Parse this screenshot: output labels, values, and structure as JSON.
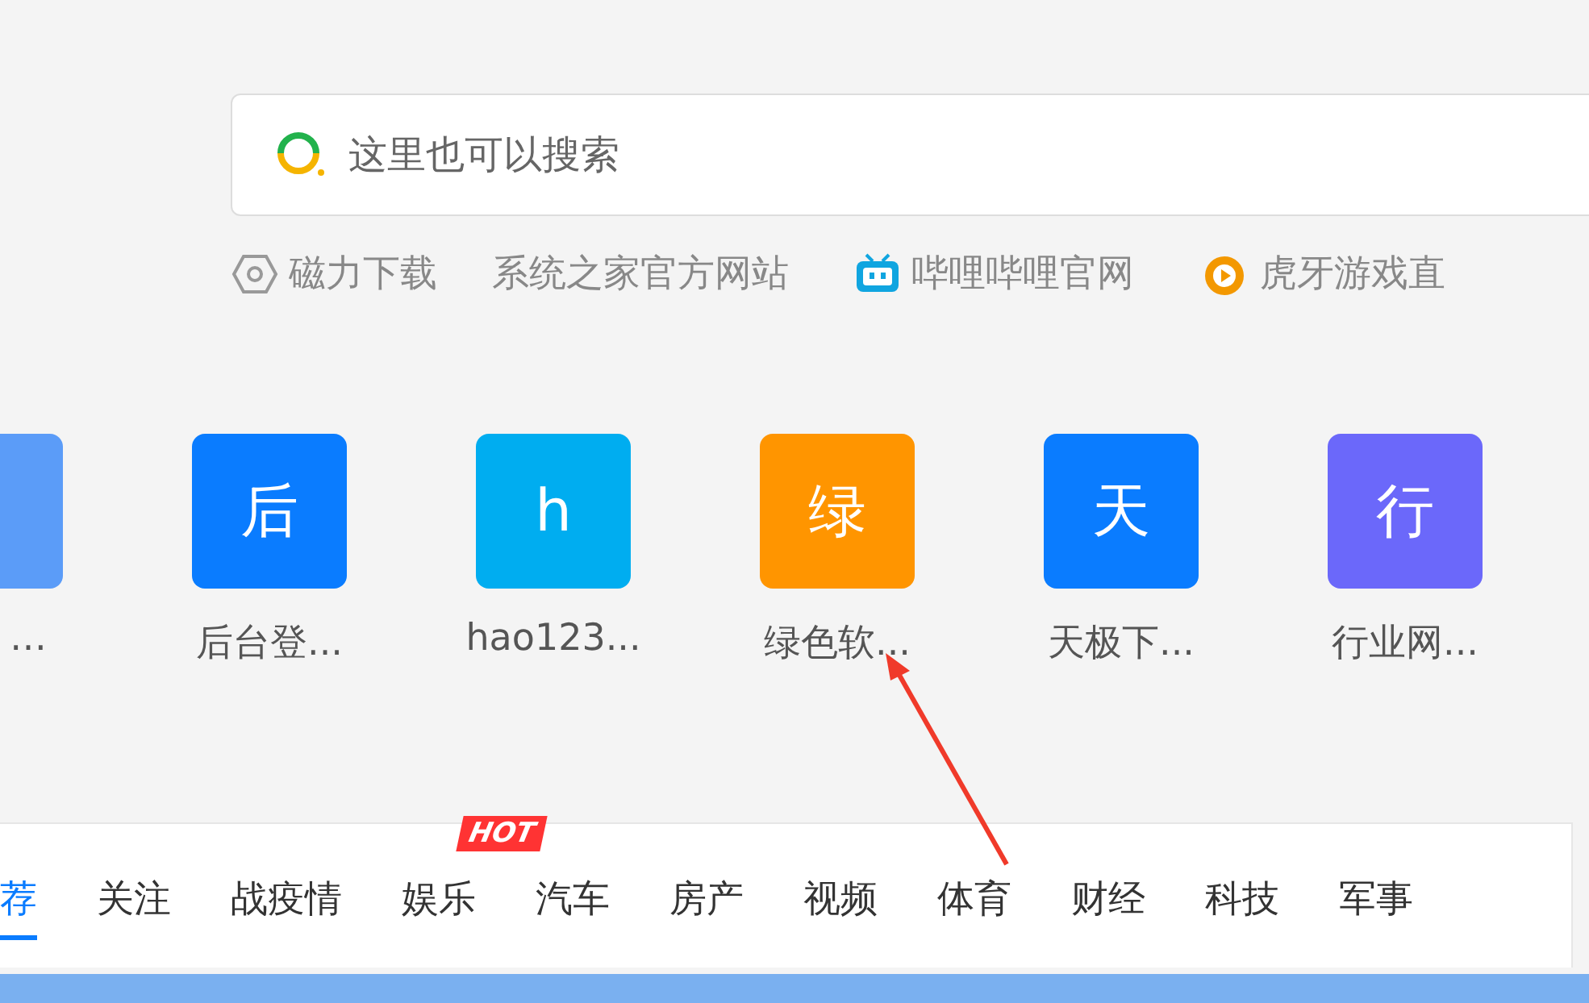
{
  "search": {
    "placeholder": "这里也可以搜索"
  },
  "quick_links": [
    {
      "kind": "magnet",
      "label": "磁力下载"
    },
    {
      "kind": "plain",
      "label": "系统之家官方网站"
    },
    {
      "kind": "tv",
      "label": "哔哩哔哩官网"
    },
    {
      "kind": "tiger",
      "label": "虎牙游戏直"
    }
  ],
  "shortcuts": [
    {
      "label": "…",
      "color": "#5b9cf8"
    },
    {
      "glyph": "后",
      "label": "后台登...",
      "color": "#0a7cff"
    },
    {
      "glyph": "h",
      "label": "hao123...",
      "color": "#00adf0"
    },
    {
      "glyph": "绿",
      "label": "绿色软...",
      "color": "#ff9500"
    },
    {
      "glyph": "天",
      "label": "天极下...",
      "color": "#0a7cff"
    },
    {
      "glyph": "行",
      "label": "行业网...",
      "color": "#6b68fa"
    }
  ],
  "news_tabs": [
    {
      "label": "荐",
      "selected": true
    },
    {
      "label": "关注",
      "selected": false
    },
    {
      "label": "战疫情",
      "selected": false
    },
    {
      "label": "娱乐",
      "selected": false,
      "badge": "HOT"
    },
    {
      "label": "汽车",
      "selected": false
    },
    {
      "label": "房产",
      "selected": false
    },
    {
      "label": "视频",
      "selected": false
    },
    {
      "label": "体育",
      "selected": false
    },
    {
      "label": "财经",
      "selected": false
    },
    {
      "label": "科技",
      "selected": false
    },
    {
      "label": "军事",
      "selected": false
    }
  ]
}
